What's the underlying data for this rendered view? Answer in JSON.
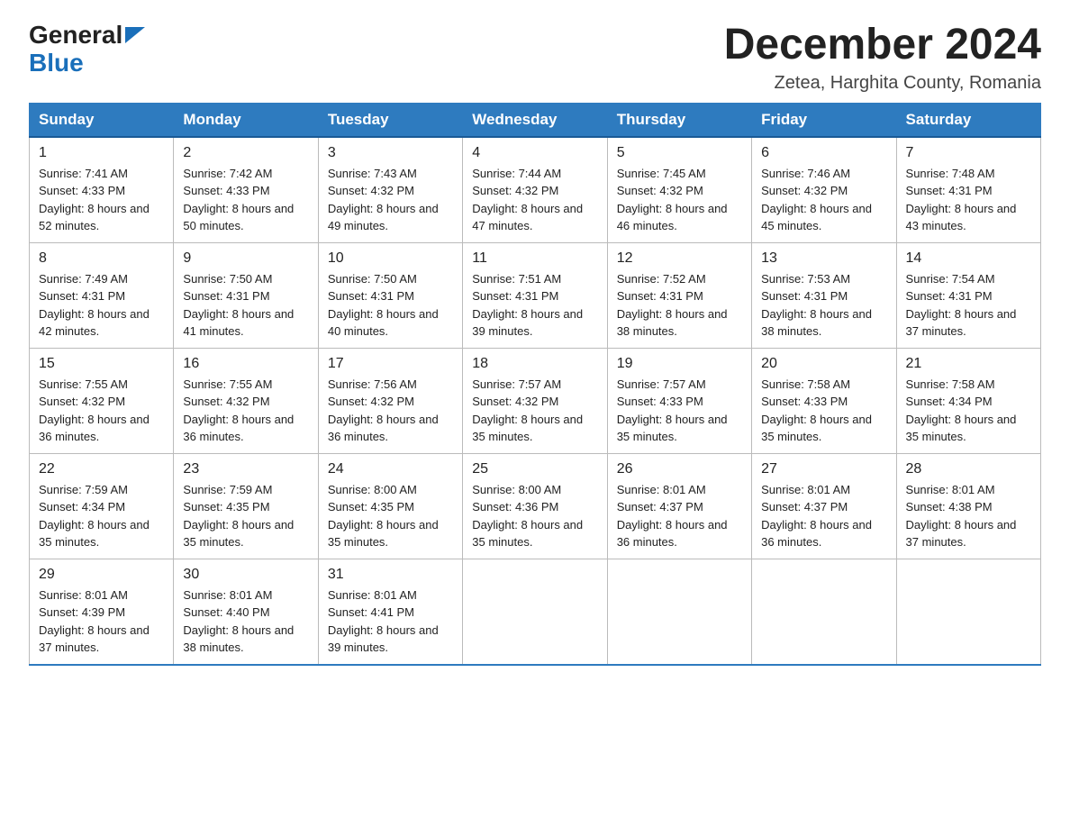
{
  "logo": {
    "text_general": "General",
    "text_blue": "Blue"
  },
  "title": "December 2024",
  "location": "Zetea, Harghita County, Romania",
  "days_of_week": [
    "Sunday",
    "Monday",
    "Tuesday",
    "Wednesday",
    "Thursday",
    "Friday",
    "Saturday"
  ],
  "weeks": [
    [
      {
        "day": "1",
        "sunrise": "7:41 AM",
        "sunset": "4:33 PM",
        "daylight": "8 hours and 52 minutes."
      },
      {
        "day": "2",
        "sunrise": "7:42 AM",
        "sunset": "4:33 PM",
        "daylight": "8 hours and 50 minutes."
      },
      {
        "day": "3",
        "sunrise": "7:43 AM",
        "sunset": "4:32 PM",
        "daylight": "8 hours and 49 minutes."
      },
      {
        "day": "4",
        "sunrise": "7:44 AM",
        "sunset": "4:32 PM",
        "daylight": "8 hours and 47 minutes."
      },
      {
        "day": "5",
        "sunrise": "7:45 AM",
        "sunset": "4:32 PM",
        "daylight": "8 hours and 46 minutes."
      },
      {
        "day": "6",
        "sunrise": "7:46 AM",
        "sunset": "4:32 PM",
        "daylight": "8 hours and 45 minutes."
      },
      {
        "day": "7",
        "sunrise": "7:48 AM",
        "sunset": "4:31 PM",
        "daylight": "8 hours and 43 minutes."
      }
    ],
    [
      {
        "day": "8",
        "sunrise": "7:49 AM",
        "sunset": "4:31 PM",
        "daylight": "8 hours and 42 minutes."
      },
      {
        "day": "9",
        "sunrise": "7:50 AM",
        "sunset": "4:31 PM",
        "daylight": "8 hours and 41 minutes."
      },
      {
        "day": "10",
        "sunrise": "7:50 AM",
        "sunset": "4:31 PM",
        "daylight": "8 hours and 40 minutes."
      },
      {
        "day": "11",
        "sunrise": "7:51 AM",
        "sunset": "4:31 PM",
        "daylight": "8 hours and 39 minutes."
      },
      {
        "day": "12",
        "sunrise": "7:52 AM",
        "sunset": "4:31 PM",
        "daylight": "8 hours and 38 minutes."
      },
      {
        "day": "13",
        "sunrise": "7:53 AM",
        "sunset": "4:31 PM",
        "daylight": "8 hours and 38 minutes."
      },
      {
        "day": "14",
        "sunrise": "7:54 AM",
        "sunset": "4:31 PM",
        "daylight": "8 hours and 37 minutes."
      }
    ],
    [
      {
        "day": "15",
        "sunrise": "7:55 AM",
        "sunset": "4:32 PM",
        "daylight": "8 hours and 36 minutes."
      },
      {
        "day": "16",
        "sunrise": "7:55 AM",
        "sunset": "4:32 PM",
        "daylight": "8 hours and 36 minutes."
      },
      {
        "day": "17",
        "sunrise": "7:56 AM",
        "sunset": "4:32 PM",
        "daylight": "8 hours and 36 minutes."
      },
      {
        "day": "18",
        "sunrise": "7:57 AM",
        "sunset": "4:32 PM",
        "daylight": "8 hours and 35 minutes."
      },
      {
        "day": "19",
        "sunrise": "7:57 AM",
        "sunset": "4:33 PM",
        "daylight": "8 hours and 35 minutes."
      },
      {
        "day": "20",
        "sunrise": "7:58 AM",
        "sunset": "4:33 PM",
        "daylight": "8 hours and 35 minutes."
      },
      {
        "day": "21",
        "sunrise": "7:58 AM",
        "sunset": "4:34 PM",
        "daylight": "8 hours and 35 minutes."
      }
    ],
    [
      {
        "day": "22",
        "sunrise": "7:59 AM",
        "sunset": "4:34 PM",
        "daylight": "8 hours and 35 minutes."
      },
      {
        "day": "23",
        "sunrise": "7:59 AM",
        "sunset": "4:35 PM",
        "daylight": "8 hours and 35 minutes."
      },
      {
        "day": "24",
        "sunrise": "8:00 AM",
        "sunset": "4:35 PM",
        "daylight": "8 hours and 35 minutes."
      },
      {
        "day": "25",
        "sunrise": "8:00 AM",
        "sunset": "4:36 PM",
        "daylight": "8 hours and 35 minutes."
      },
      {
        "day": "26",
        "sunrise": "8:01 AM",
        "sunset": "4:37 PM",
        "daylight": "8 hours and 36 minutes."
      },
      {
        "day": "27",
        "sunrise": "8:01 AM",
        "sunset": "4:37 PM",
        "daylight": "8 hours and 36 minutes."
      },
      {
        "day": "28",
        "sunrise": "8:01 AM",
        "sunset": "4:38 PM",
        "daylight": "8 hours and 37 minutes."
      }
    ],
    [
      {
        "day": "29",
        "sunrise": "8:01 AM",
        "sunset": "4:39 PM",
        "daylight": "8 hours and 37 minutes."
      },
      {
        "day": "30",
        "sunrise": "8:01 AM",
        "sunset": "4:40 PM",
        "daylight": "8 hours and 38 minutes."
      },
      {
        "day": "31",
        "sunrise": "8:01 AM",
        "sunset": "4:41 PM",
        "daylight": "8 hours and 39 minutes."
      },
      null,
      null,
      null,
      null
    ]
  ]
}
